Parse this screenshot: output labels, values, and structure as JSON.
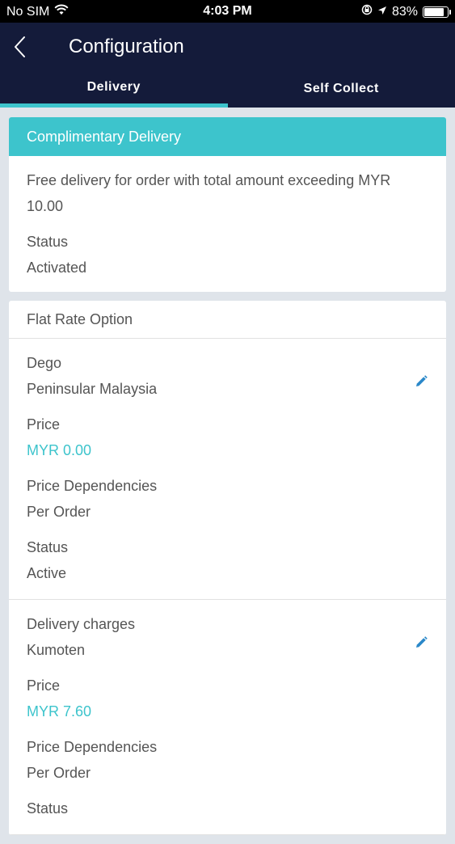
{
  "status_bar": {
    "carrier": "No SIM",
    "time": "4:03 PM",
    "battery": "83%",
    "battery_level": 0.83
  },
  "header": {
    "title": "Configuration",
    "tabs": [
      {
        "label": "Delivery",
        "active": true
      },
      {
        "label": "Self Collect",
        "active": false
      }
    ]
  },
  "complimentary": {
    "title": "Complimentary Delivery",
    "description": "Free delivery for order with total amount exceeding MYR 10.00",
    "status_label": "Status",
    "status_value": "Activated"
  },
  "flat_rate": {
    "title": "Flat Rate Option",
    "options": [
      {
        "name": "Dego",
        "region": "Peninsular Malaysia",
        "price_label": "Price",
        "price": "MYR 0.00",
        "dep_label": "Price Dependencies",
        "dep_value": "Per Order",
        "status_label": "Status",
        "status_value": "Active"
      },
      {
        "name": "Delivery charges",
        "region": "Kumoten",
        "price_label": "Price",
        "price": "MYR 7.60",
        "dep_label": "Price Dependencies",
        "dep_value": "Per Order",
        "status_label": "Status"
      }
    ]
  },
  "colors": {
    "accent": "#3dc4cc",
    "header_bg": "#141b3a",
    "page_bg": "#dfe4ea",
    "edit_icon": "#2a88c9"
  }
}
